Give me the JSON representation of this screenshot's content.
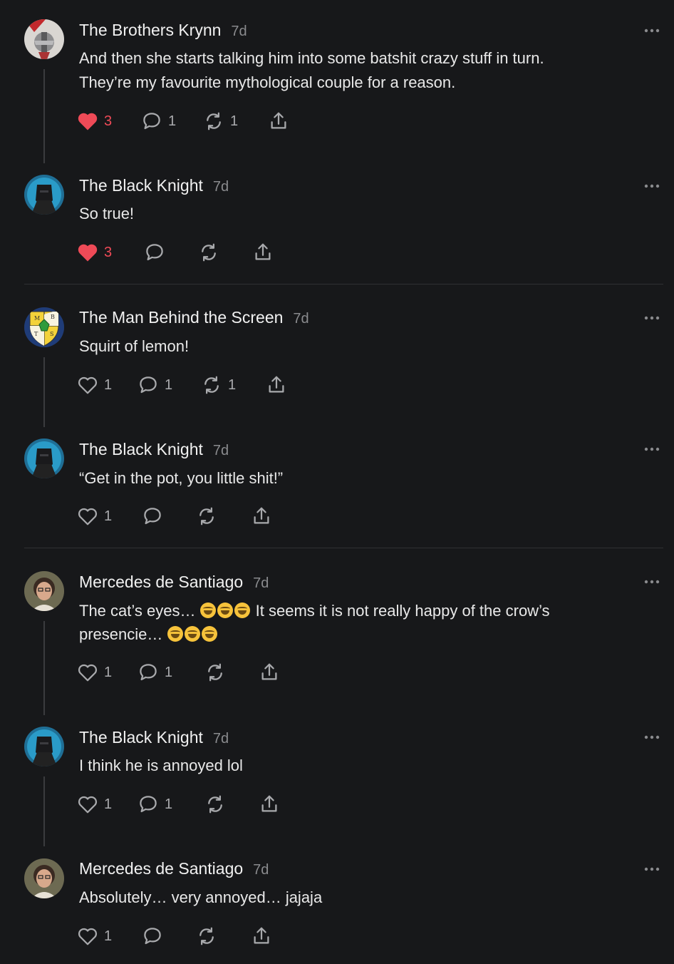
{
  "comments": [
    {
      "name": "The Brothers Krynn",
      "time": "7d",
      "lines": [
        "And then she starts talking him into some batshit crazy stuff in turn.",
        "They’re my favourite mythological couple for a reason."
      ],
      "likes": "3",
      "liked": true,
      "replies": "1",
      "restacks": "1"
    },
    {
      "name": "The Black Knight",
      "time": "7d",
      "lines": [
        "So true!"
      ],
      "likes": "3",
      "liked": true,
      "replies": "",
      "restacks": ""
    },
    {
      "name": "The Man Behind the Screen",
      "time": "7d",
      "lines": [
        "Squirt of lemon!"
      ],
      "likes": "1",
      "liked": false,
      "replies": "1",
      "restacks": "1"
    },
    {
      "name": "The Black Knight",
      "time": "7d",
      "lines": [
        "“Get in the pot, you little shit!”"
      ],
      "likes": "1",
      "liked": false,
      "replies": "",
      "restacks": ""
    },
    {
      "name": "Mercedes de Santiago",
      "time": "7d",
      "line1_a": "The cat’s eyes… ",
      "line1_b": " It seems it is not really happy of the crow’s",
      "line2_a": "presencie… ",
      "likes": "1",
      "liked": false,
      "replies": "1",
      "restacks": ""
    },
    {
      "name": "The Black Knight",
      "time": "7d",
      "lines": [
        "I think he is annoyed lol"
      ],
      "likes": "1",
      "liked": false,
      "replies": "1",
      "restacks": ""
    },
    {
      "name": "Mercedes de Santiago",
      "time": "7d",
      "lines": [
        "Absolutely… very annoyed… jajaja"
      ],
      "likes": "1",
      "liked": false,
      "replies": "",
      "restacks": ""
    }
  ],
  "colors": {
    "liked": "#ef4a57",
    "icon": "#a9aaad",
    "background": "#17181a"
  },
  "icons": {
    "like": "heart-icon",
    "reply": "comment-icon",
    "restack": "restack-icon",
    "share": "share-icon",
    "more": "more-icon"
  }
}
